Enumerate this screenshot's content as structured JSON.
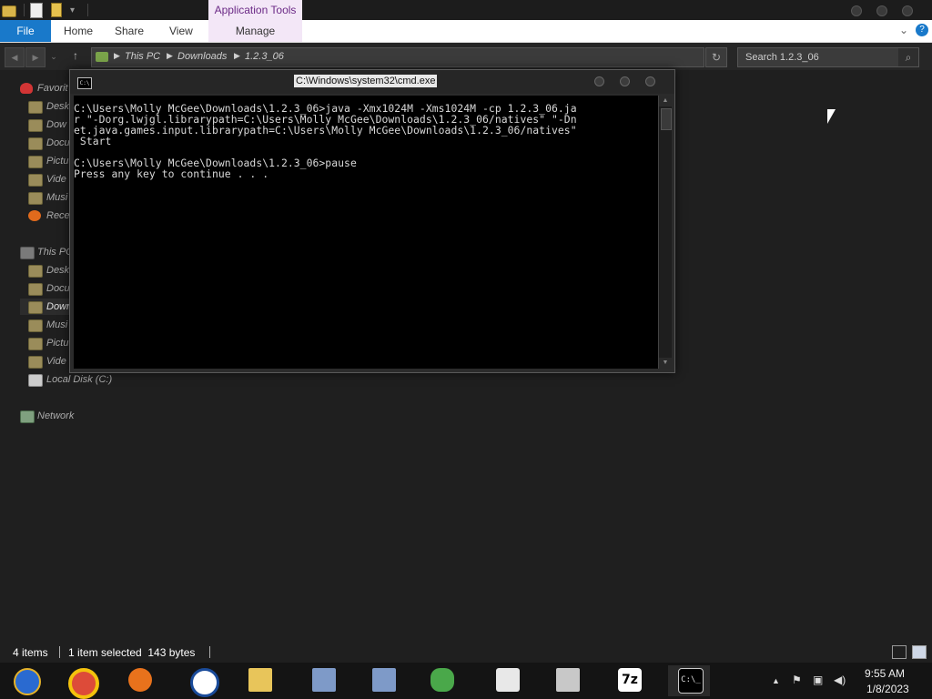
{
  "window": {
    "contextual_tab_group": "Application Tools"
  },
  "ribbon": {
    "tabs": [
      {
        "label": "File"
      },
      {
        "label": "Home"
      },
      {
        "label": "Share"
      },
      {
        "label": "View"
      },
      {
        "label": "Manage"
      }
    ],
    "help": "?"
  },
  "address_bar": {
    "breadcrumbs": [
      "This PC",
      "Downloads",
      "1.2.3_06"
    ],
    "search_placeholder": "Search 1.2.3_06"
  },
  "sidebar": {
    "favorites_label": "Favorit",
    "favorites": [
      "Desk",
      "Dow",
      "Docu",
      "Pictu",
      "Vide",
      "Musi",
      "Rece"
    ],
    "this_pc_label": "This PC",
    "this_pc": [
      "Desk",
      "Docu",
      "Down",
      "Musi",
      "Pictu",
      "Vide",
      "Local Disk (C:)"
    ],
    "network_label": "Network"
  },
  "status_bar": {
    "item_count": "4 items",
    "selection": "1 item selected  143 bytes"
  },
  "cmd": {
    "title": "C:\\Windows\\system32\\cmd.exe",
    "icon_text": "C:\\",
    "output": "C:\\Users\\Molly McGee\\Downloads\\1.2.3_06>java -Xmx1024M -Xms1024M -cp 1.2.3_06.ja\nr \"-Dorg.lwjgl.librarypath=C:\\Users\\Molly McGee\\Downloads\\1.2.3_06/natives\" \"-Dn\net.java.games.input.librarypath=C:\\Users\\Molly McGee\\Downloads\\1.2.3_06/natives\"\n Start\n\nC:\\Users\\Molly McGee\\Downloads\\1.2.3_06>pause\nPress any key to continue . . ."
  },
  "taskbar": {
    "items": [
      {
        "name": "start-button",
        "icon": "windows-orb-icon"
      },
      {
        "name": "chrome",
        "icon": "chrome-icon"
      },
      {
        "name": "firefox",
        "icon": "firefox-icon"
      },
      {
        "name": "obama",
        "icon": "campaign-logo-icon"
      },
      {
        "name": "file-explorer",
        "icon": "folder-icon"
      },
      {
        "name": "installer-1",
        "icon": "setup-icon"
      },
      {
        "name": "installer-2",
        "icon": "setup-icon"
      },
      {
        "name": "messenger",
        "icon": "people-icon"
      },
      {
        "name": "java",
        "icon": "java-icon"
      },
      {
        "name": "archive",
        "icon": "archive-icon"
      },
      {
        "name": "7zip",
        "icon": "7zip-icon",
        "label": "7z"
      },
      {
        "name": "cmd",
        "icon": "cmd-icon",
        "label": "C:\\_"
      }
    ],
    "clock_time": "9:55 AM",
    "clock_date": "1/8/2023"
  }
}
